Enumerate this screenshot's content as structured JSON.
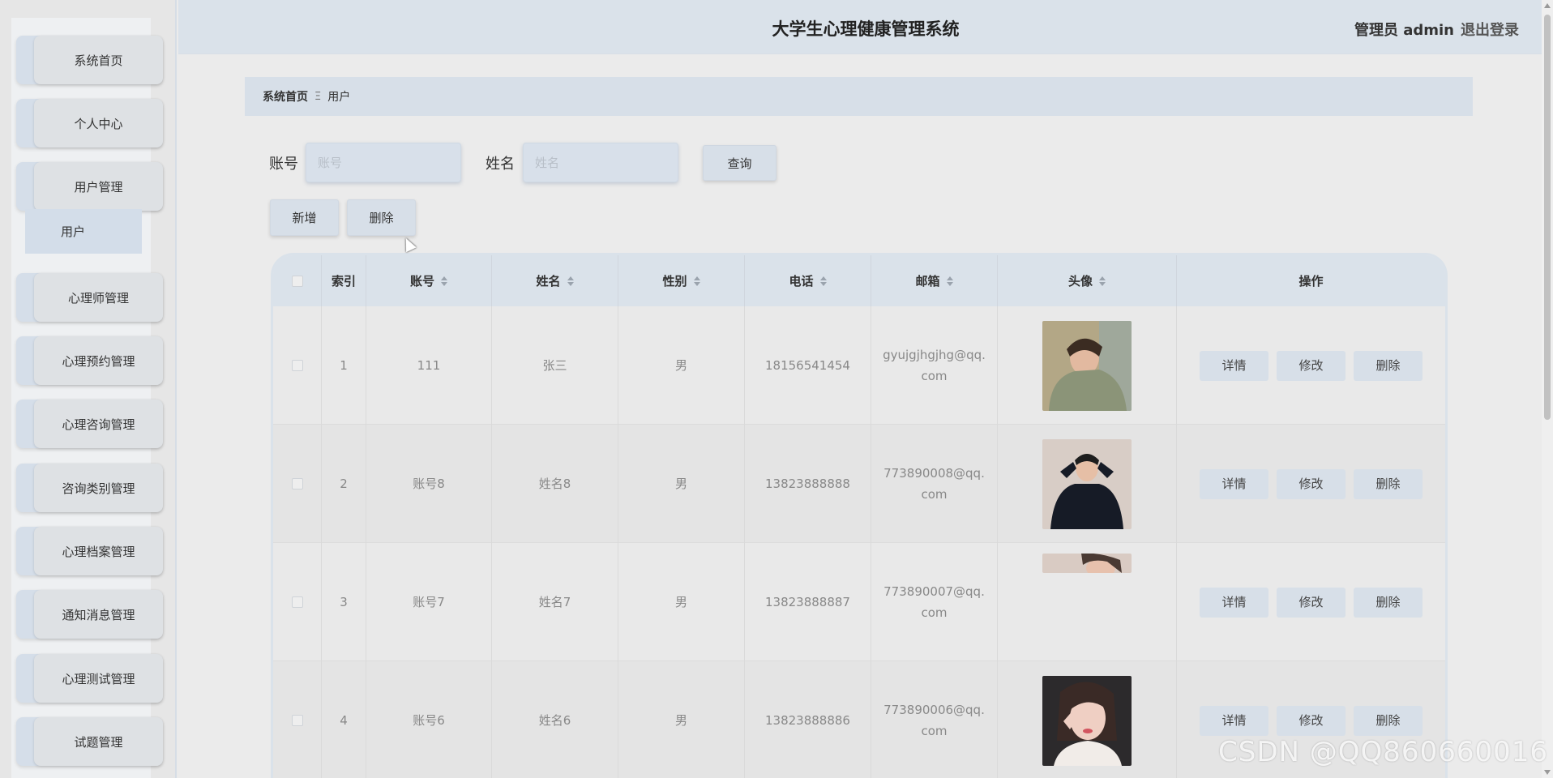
{
  "header": {
    "title": "大学生心理健康管理系统",
    "admin_label": "管理员 admin",
    "logout_label": "退出登录"
  },
  "sidebar": {
    "items": [
      {
        "label": "系统首页"
      },
      {
        "label": "个人中心"
      },
      {
        "label": "用户管理"
      },
      {
        "label": "心理师管理"
      },
      {
        "label": "心理预约管理"
      },
      {
        "label": "心理咨询管理"
      },
      {
        "label": "咨询类别管理"
      },
      {
        "label": "心理档案管理"
      },
      {
        "label": "通知消息管理"
      },
      {
        "label": "心理测试管理"
      },
      {
        "label": "试题管理"
      }
    ],
    "sub_item": "用户"
  },
  "breadcrumb": {
    "home": "系统首页",
    "separator": "Ξ",
    "current": "用户"
  },
  "search": {
    "account_label": "账号",
    "account_placeholder": "账号",
    "account_value": "",
    "name_label": "姓名",
    "name_placeholder": "姓名",
    "name_value": "",
    "query_label": "查询"
  },
  "actions": {
    "add_label": "新增",
    "delete_label": "删除"
  },
  "table": {
    "columns": [
      "索引",
      "账号",
      "姓名",
      "性别",
      "电话",
      "邮箱",
      "头像",
      "操作"
    ],
    "rows": [
      {
        "index": "1",
        "account": "111",
        "name": "张三",
        "gender": "男",
        "phone": "18156541454",
        "email": "gyujgjhgjhg@qq.com"
      },
      {
        "index": "2",
        "account": "账号8",
        "name": "姓名8",
        "gender": "男",
        "phone": "13823888888",
        "email": "773890008@qq.com"
      },
      {
        "index": "3",
        "account": "账号7",
        "name": "姓名7",
        "gender": "男",
        "phone": "13823888887",
        "email": "773890007@qq.com"
      },
      {
        "index": "4",
        "account": "账号6",
        "name": "姓名6",
        "gender": "男",
        "phone": "13823888886",
        "email": "773890006@qq.com"
      }
    ],
    "op_labels": {
      "detail": "详情",
      "edit": "修改",
      "delete": "删除"
    }
  },
  "watermark": "CSDN @QQ860660016"
}
